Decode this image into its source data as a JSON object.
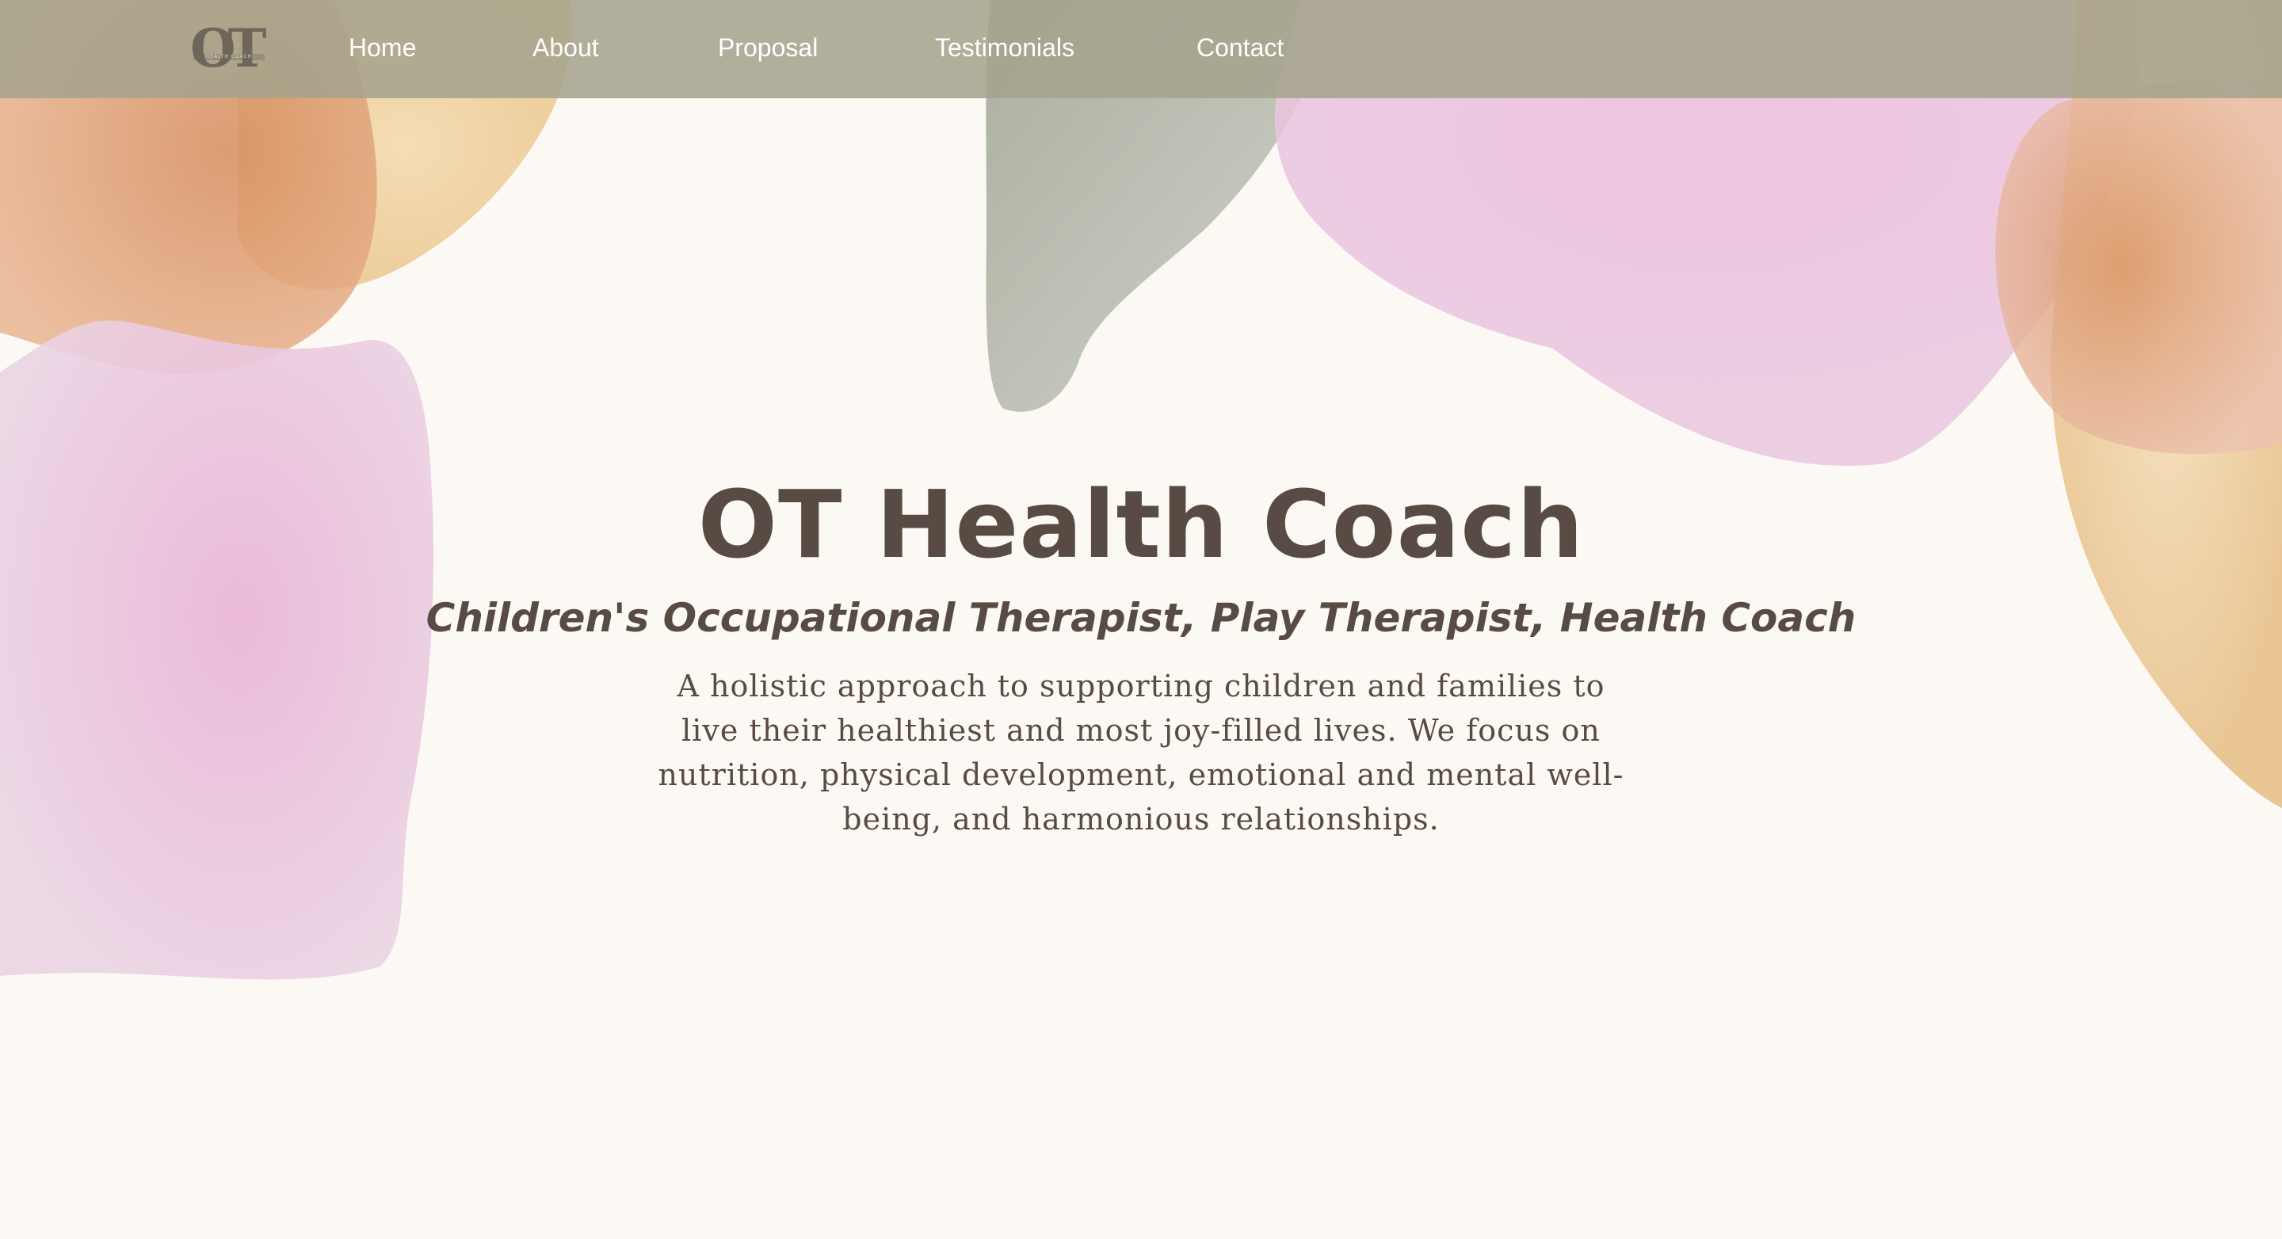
{
  "nav": {
    "logo": {
      "letters": "OT",
      "subtext": "HEALTH COACH"
    },
    "links": [
      {
        "label": "Home"
      },
      {
        "label": "About"
      },
      {
        "label": "Proposal"
      },
      {
        "label": "Testimonials"
      },
      {
        "label": "Contact"
      }
    ]
  },
  "hero": {
    "title": "OT Health Coach",
    "subtitle": "Children's Occupational Therapist, Play Therapist, Health Coach",
    "body": "A holistic approach to supporting children and families to live their healthiest and most joy-filled lives. We focus on nutrition, physical development, emotional and mental well-being, and harmonious relationships."
  },
  "colors": {
    "nav_bg": "#a4a38d",
    "page_bg": "#fcf8f3",
    "text": "#574b43",
    "nav_text": "#ffffff",
    "watercolor_pink": "#e6bcd9",
    "watercolor_orange": "#d99b68",
    "watercolor_yellow": "#ecc98f",
    "watercolor_sage": "#a9ad9d"
  }
}
